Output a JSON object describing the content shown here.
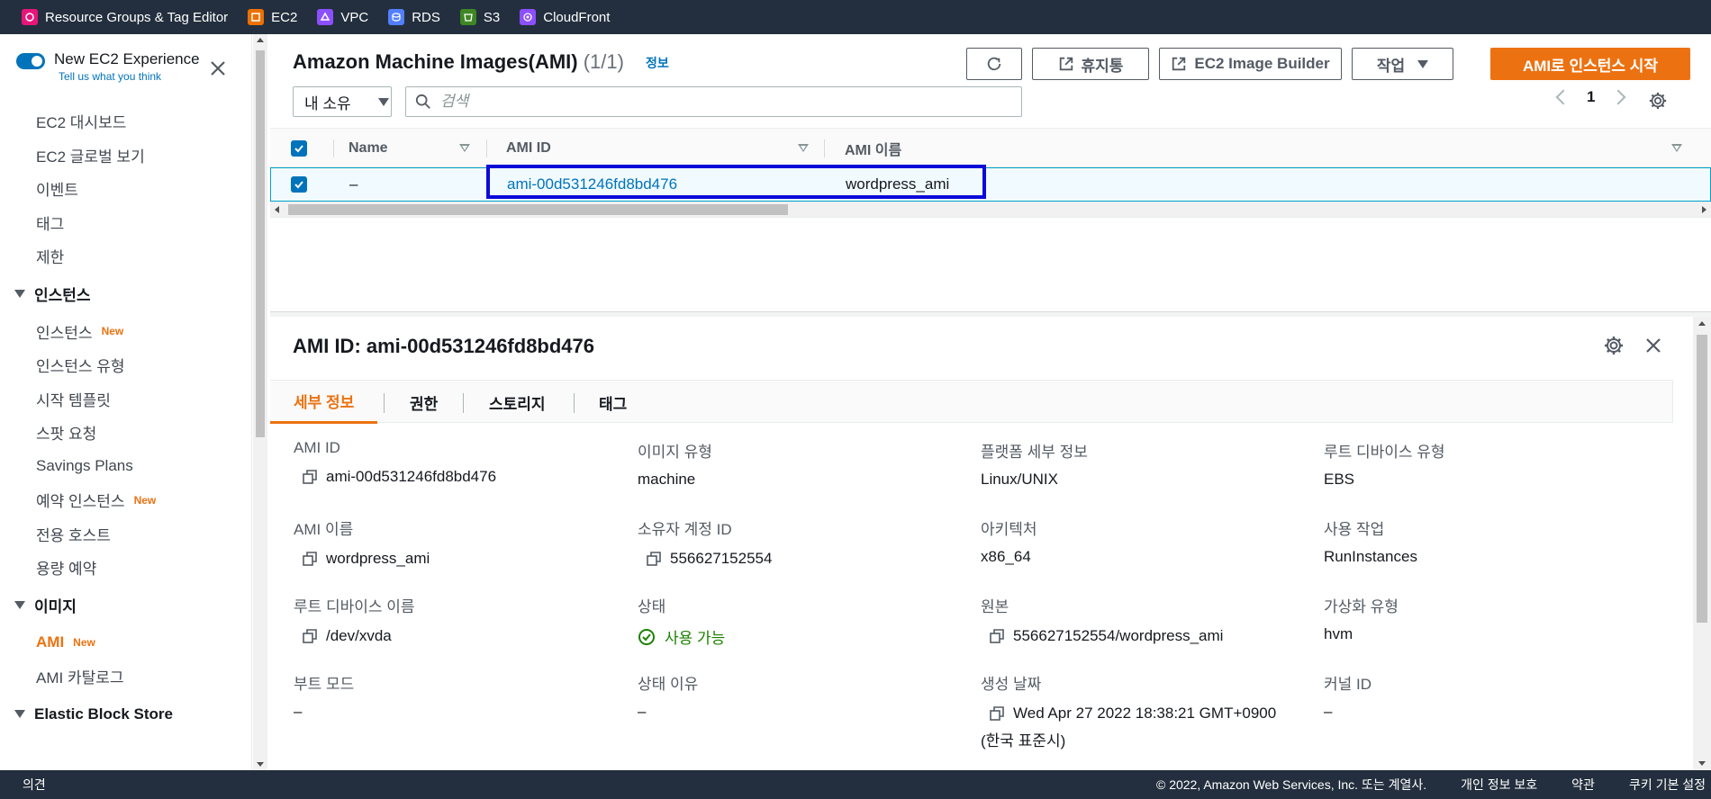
{
  "topbar": {
    "services": [
      {
        "label": "Resource Groups & Tag Editor",
        "icon": "resource-groups-icon",
        "color": "#e7157b"
      },
      {
        "label": "EC2",
        "icon": "ec2-icon",
        "color": "#ed7100"
      },
      {
        "label": "VPC",
        "icon": "vpc-icon",
        "color": "#8c4fff"
      },
      {
        "label": "RDS",
        "icon": "rds-icon",
        "color": "#527fff"
      },
      {
        "label": "S3",
        "icon": "s3-icon",
        "color": "#3f8624"
      },
      {
        "label": "CloudFront",
        "icon": "cloudfront-icon",
        "color": "#8c4fff"
      }
    ]
  },
  "sidebar": {
    "new_experience": {
      "title": "New EC2 Experience",
      "subtitle": "Tell us what you think",
      "enabled": true
    },
    "top_items": [
      "EC2 대시보드",
      "EC2 글로벌 보기",
      "이벤트",
      "태그",
      "제한"
    ],
    "instances_section": {
      "title": "인스턴스",
      "items": [
        {
          "label": "인스턴스",
          "badge": "New"
        },
        {
          "label": "인스턴스 유형",
          "badge": ""
        },
        {
          "label": "시작 템플릿",
          "badge": ""
        },
        {
          "label": "스팟 요청",
          "badge": ""
        },
        {
          "label": "Savings Plans",
          "badge": ""
        },
        {
          "label": "예약 인스턴스",
          "badge": "New"
        },
        {
          "label": "전용 호스트",
          "badge": ""
        },
        {
          "label": "용량 예약",
          "badge": ""
        }
      ]
    },
    "images_section": {
      "title": "이미지",
      "items": [
        {
          "label": "AMI",
          "badge": "New",
          "active": true
        },
        {
          "label": "AMI 카탈로그",
          "badge": "",
          "active": false
        }
      ]
    },
    "ebs_section": {
      "title": "Elastic Block Store"
    }
  },
  "main": {
    "title": "Amazon Machine Images(AMI)",
    "count": "(1/1)",
    "info": "정보",
    "buttons": {
      "recycle_bin": "휴지통",
      "image_builder": "EC2 Image Builder",
      "actions": "작업",
      "launch": "AMI로 인스턴스 시작"
    },
    "filter_select": "내 소유",
    "search_placeholder": "검색",
    "page": "1",
    "columns": [
      "Name",
      "AMI ID",
      "AMI 이름"
    ],
    "rows": [
      {
        "name": "–",
        "ami_id": "ami-00d531246fd8bd476",
        "ami_name": "wordpress_ami",
        "selected": true
      }
    ]
  },
  "detail": {
    "title": "AMI ID: ami-00d531246fd8bd476",
    "tabs": [
      "세부 정보",
      "권한",
      "스토리지",
      "태그"
    ],
    "active_tab": "세부 정보",
    "fields": {
      "ami_id": {
        "label": "AMI ID",
        "value": "ami-00d531246fd8bd476"
      },
      "image_type": {
        "label": "이미지 유형",
        "value": "machine"
      },
      "platform": {
        "label": "플랫폼 세부 정보",
        "value": "Linux/UNIX"
      },
      "root_device_type": {
        "label": "루트 디바이스 유형",
        "value": "EBS"
      },
      "ami_name": {
        "label": "AMI 이름",
        "value": "wordpress_ami"
      },
      "owner": {
        "label": "소유자 계정 ID",
        "value": "556627152554"
      },
      "architecture": {
        "label": "아키텍처",
        "value": "x86_64"
      },
      "usage": {
        "label": "사용 작업",
        "value": "RunInstances"
      },
      "root_device_name": {
        "label": "루트 디바이스 이름",
        "value": "/dev/xvda"
      },
      "state": {
        "label": "상태",
        "value": "사용 가능",
        "color": "#1d8102"
      },
      "source": {
        "label": "원본",
        "value": "556627152554/wordpress_ami"
      },
      "virtualization": {
        "label": "가상화 유형",
        "value": "hvm"
      },
      "boot_mode": {
        "label": "부트 모드",
        "value": "–"
      },
      "state_reason": {
        "label": "상태 이유",
        "value": "–"
      },
      "created": {
        "label": "생성 날짜",
        "value": "Wed Apr 27 2022 18:38:21 GMT+0900",
        "value2": "(한국 표준시)"
      },
      "kernel_id": {
        "label": "커널 ID",
        "value": "–"
      }
    }
  },
  "footer": {
    "feedback": "의견",
    "copyright": "© 2022, Amazon Web Services, Inc. 또는 계열사.",
    "privacy": "개인 정보 보호",
    "terms": "약관",
    "cookies": "쿠키 기본 설정"
  },
  "colors": {
    "accent": "#ec7211",
    "link": "#0073bb",
    "nav_bg": "#232f3e",
    "highlight_box": "#0a0ad8"
  }
}
